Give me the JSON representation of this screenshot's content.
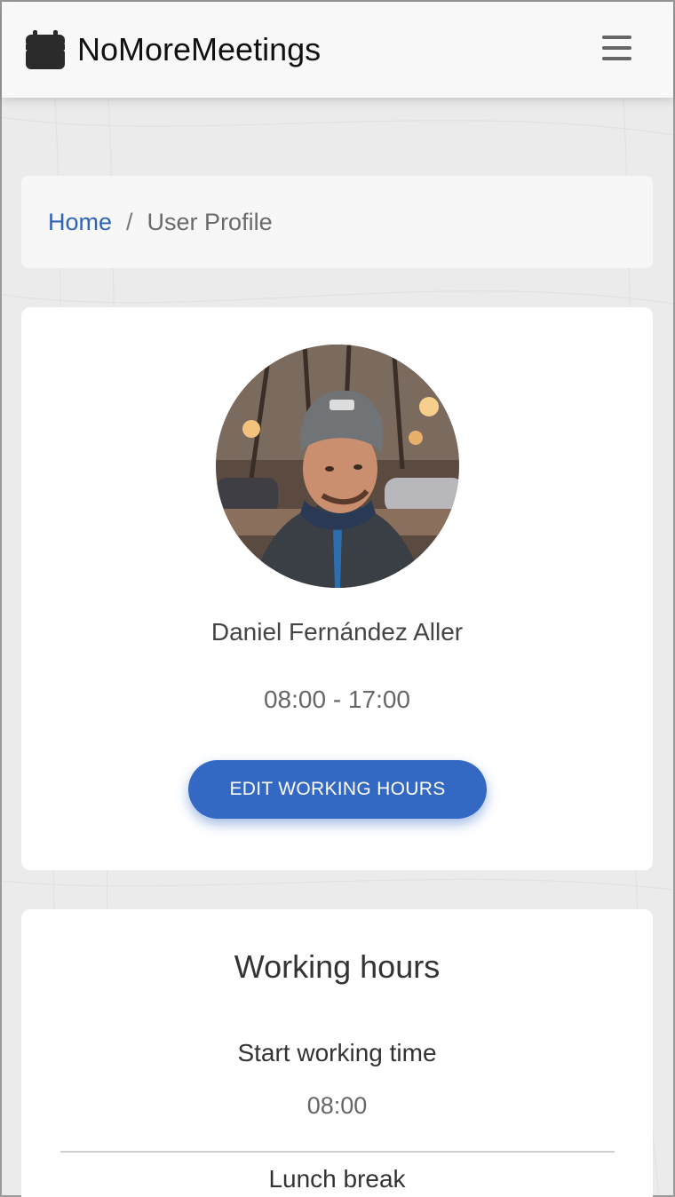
{
  "navbar": {
    "brand_text": "NoMoreMeetings",
    "brand_icon": "calendar-icon",
    "menu_icon": "hamburger-menu-icon"
  },
  "breadcrumb": {
    "home_label": "Home",
    "separator": "/",
    "current_label": "User Profile"
  },
  "profile": {
    "name": "Daniel Fernández Aller",
    "working_hours": "08:00 - 17:00",
    "edit_button_label": "EDIT WORKING HOURS"
  },
  "working_hours_card": {
    "title": "Working hours",
    "start_label": "Start working time",
    "start_value": "08:00",
    "lunch_label": "Lunch break"
  },
  "colors": {
    "accent": "#3469c3",
    "link": "#2f63b5",
    "background": "#ebebeb",
    "navbar": "#f8f8f8"
  }
}
